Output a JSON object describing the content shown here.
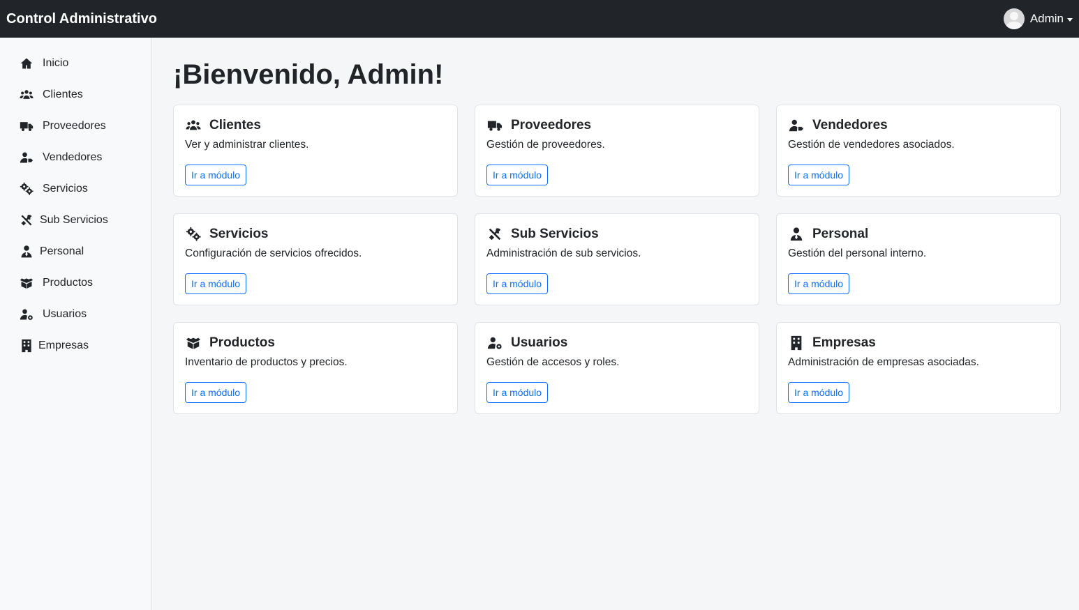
{
  "navbar": {
    "brand": "Control Administrativo",
    "user_name": "Admin",
    "user_icon": "user-avatar",
    "caret_icon": "chevron-down-icon"
  },
  "sidebar": {
    "items": [
      {
        "label": "Inicio",
        "icon": "home-icon"
      },
      {
        "label": "Clientes",
        "icon": "users-icon"
      },
      {
        "label": "Proveedores",
        "icon": "truck-icon"
      },
      {
        "label": "Vendedores",
        "icon": "user-tag-icon"
      },
      {
        "label": "Servicios",
        "icon": "gears-icon"
      },
      {
        "label": "Sub Servicios",
        "icon": "tools-icon"
      },
      {
        "label": "Personal",
        "icon": "user-tie-icon"
      },
      {
        "label": "Productos",
        "icon": "box-open-icon"
      },
      {
        "label": "Usuarios",
        "icon": "user-gear-icon"
      },
      {
        "label": "Empresas",
        "icon": "building-icon"
      }
    ]
  },
  "main": {
    "title": "¡Bienvenido, Admin!",
    "button_label": "Ir a módulo",
    "cards": [
      {
        "title": "Clientes",
        "text": "Ver y administrar clientes.",
        "icon": "users-icon"
      },
      {
        "title": "Proveedores",
        "text": "Gestión de proveedores.",
        "icon": "truck-icon"
      },
      {
        "title": "Vendedores",
        "text": "Gestión de vendedores asociados.",
        "icon": "user-tag-icon"
      },
      {
        "title": "Servicios",
        "text": "Configuración de servicios ofrecidos.",
        "icon": "gears-icon"
      },
      {
        "title": "Sub Servicios",
        "text": "Administración de sub servicios.",
        "icon": "tools-icon"
      },
      {
        "title": "Personal",
        "text": "Gestión del personal interno.",
        "icon": "user-tie-icon"
      },
      {
        "title": "Productos",
        "text": "Inventario de productos y precios.",
        "icon": "box-open-icon"
      },
      {
        "title": "Usuarios",
        "text": "Gestión de accesos y roles.",
        "icon": "user-gear-icon"
      },
      {
        "title": "Empresas",
        "text": "Administración de empresas asociadas.",
        "icon": "building-icon"
      }
    ]
  },
  "colors": {
    "navbar_bg": "#212529",
    "accent": "#0d6efd",
    "sidebar_bg": "#f8f9fa",
    "page_bg": "#f5f6f7"
  }
}
